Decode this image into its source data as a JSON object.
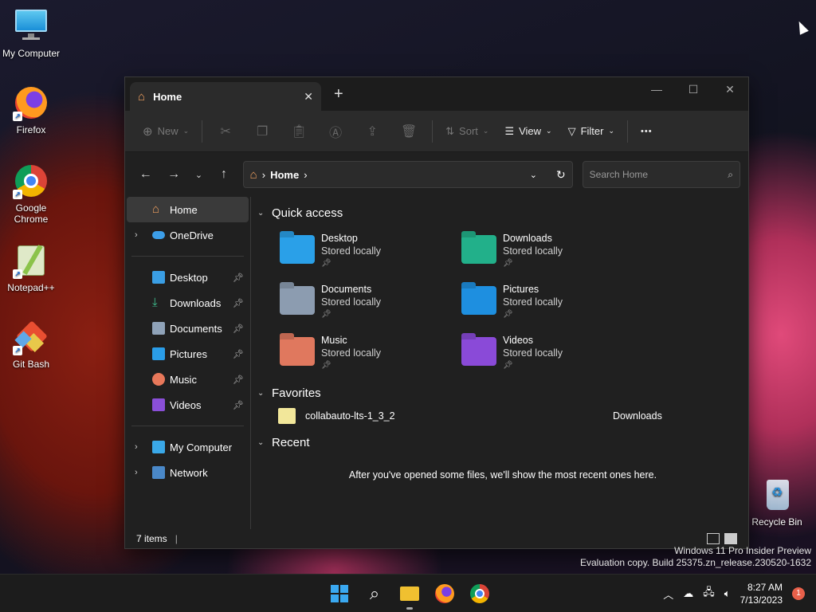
{
  "desktop": {
    "icons": [
      {
        "label": "My Computer"
      },
      {
        "label": "Firefox"
      },
      {
        "label": "Google Chrome"
      },
      {
        "label": "Notepad++"
      },
      {
        "label": "Git Bash"
      },
      {
        "label": "Recycle Bin"
      }
    ]
  },
  "explorer": {
    "tab_title": "Home",
    "tab_close": "✕",
    "new_tab": "+",
    "window_controls": {
      "minimize": "—",
      "maximize": "☐",
      "close": "✕"
    },
    "toolbar": {
      "new_label": "New",
      "sort_label": "Sort",
      "view_label": "View",
      "filter_label": "Filter",
      "more_label": "•••"
    },
    "address": {
      "home_label": "Home",
      "separator": "›"
    },
    "search": {
      "placeholder": "Search Home"
    },
    "sidebar": {
      "home": "Home",
      "onedrive": "OneDrive",
      "pinned": [
        {
          "label": "Desktop"
        },
        {
          "label": "Downloads"
        },
        {
          "label": "Documents"
        },
        {
          "label": "Pictures"
        },
        {
          "label": "Music"
        },
        {
          "label": "Videos"
        }
      ],
      "my_computer": "My Computer",
      "network": "Network"
    },
    "quick_access": {
      "title": "Quick access",
      "items": [
        {
          "name": "Desktop",
          "sub": "Stored locally"
        },
        {
          "name": "Downloads",
          "sub": "Stored locally"
        },
        {
          "name": "Documents",
          "sub": "Stored locally"
        },
        {
          "name": "Pictures",
          "sub": "Stored locally"
        },
        {
          "name": "Music",
          "sub": "Stored locally"
        },
        {
          "name": "Videos",
          "sub": "Stored locally"
        }
      ]
    },
    "favorites": {
      "title": "Favorites",
      "items": [
        {
          "name": "collabauto-lts-1_3_2",
          "location": "Downloads"
        }
      ]
    },
    "recent": {
      "title": "Recent",
      "empty_message": "After you've opened some files, we'll show the most recent ones here."
    },
    "status": {
      "items_count": "7 items"
    }
  },
  "watermark": {
    "line1": "Windows 11 Pro Insider Preview",
    "line2": "Evaluation copy. Build 25375.zn_release.230520-1632"
  },
  "taskbar": {
    "time": "8:27 AM",
    "date": "7/13/2023",
    "notification_count": "1"
  }
}
